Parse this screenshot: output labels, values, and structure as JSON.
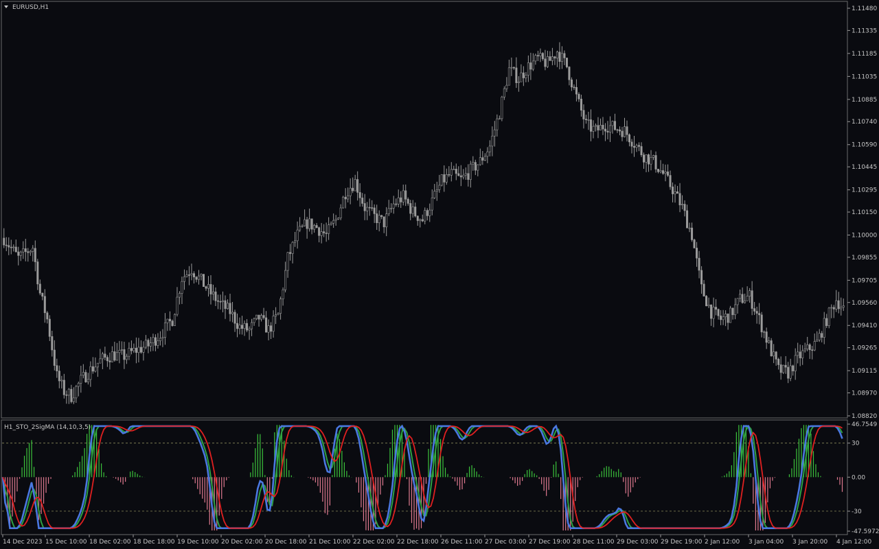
{
  "chart_data": [
    {
      "type": "candlestick",
      "title": "EURUSD,H1",
      "y_ticks": [
        "1.11480",
        "1.11335",
        "1.11185",
        "1.11035",
        "1.10885",
        "1.10740",
        "1.10590",
        "1.10445",
        "1.10295",
        "1.10150",
        "1.10000",
        "1.09855",
        "1.09705",
        "1.09560",
        "1.09410",
        "1.09265",
        "1.09115",
        "1.08970",
        "1.08820"
      ],
      "ylim": [
        1.0882,
        1.1148
      ],
      "x_ticks": [
        "14 Dec 2023",
        "15 Dec 10:00",
        "18 Dec 02:00",
        "18 Dec 18:00",
        "19 Dec 10:00",
        "20 Dec 02:00",
        "20 Dec 18:00",
        "21 Dec 10:00",
        "22 Dec 02:00",
        "22 Dec 18:00",
        "26 Dec 11:00",
        "27 Dec 03:00",
        "27 Dec 19:00",
        "28 Dec 11:00",
        "29 Dec 03:00",
        "29 Dec 19:00",
        "2 Jan 12:00",
        "3 Jan 04:00",
        "3 Jan 20:00",
        "4 Jan 12:00"
      ],
      "close_path": [
        [
          0,
          1.0998
        ],
        [
          6,
          1.0985
        ],
        [
          12,
          1.0992
        ],
        [
          15,
          1.0962
        ],
        [
          18,
          1.0945
        ],
        [
          22,
          1.0908
        ],
        [
          25,
          1.0898
        ],
        [
          28,
          1.0895
        ],
        [
          32,
          1.0905
        ],
        [
          36,
          1.0912
        ],
        [
          40,
          1.0918
        ],
        [
          45,
          1.0922
        ],
        [
          50,
          1.0921
        ],
        [
          55,
          1.0925
        ],
        [
          60,
          1.0928
        ],
        [
          65,
          1.0935
        ],
        [
          70,
          1.0945
        ],
        [
          74,
          1.0972
        ],
        [
          78,
          1.0978
        ],
        [
          82,
          1.097
        ],
        [
          86,
          1.0962
        ],
        [
          90,
          1.0955
        ],
        [
          94,
          1.095
        ],
        [
          98,
          1.094
        ],
        [
          102,
          1.0938
        ],
        [
          106,
          1.0946
        ],
        [
          110,
          1.0938
        ],
        [
          114,
          1.0948
        ],
        [
          118,
          1.0985
        ],
        [
          122,
          1.1
        ],
        [
          126,
          1.1008
        ],
        [
          130,
          1.1005
        ],
        [
          134,
          1.1
        ],
        [
          138,
          1.101
        ],
        [
          142,
          1.1028
        ],
        [
          146,
          1.1035
        ],
        [
          150,
          1.1018
        ],
        [
          154,
          1.1012
        ],
        [
          158,
          1.1008
        ],
        [
          162,
          1.102
        ],
        [
          166,
          1.1025
        ],
        [
          170,
          1.1015
        ],
        [
          174,
          1.101
        ],
        [
          178,
          1.1022
        ],
        [
          182,
          1.1035
        ],
        [
          186,
          1.104
        ],
        [
          190,
          1.1036
        ],
        [
          194,
          1.1042
        ],
        [
          198,
          1.1048
        ],
        [
          202,
          1.1058
        ],
        [
          206,
          1.108
        ],
        [
          210,
          1.1108
        ],
        [
          214,
          1.1102
        ],
        [
          218,
          1.111
        ],
        [
          222,
          1.1115
        ],
        [
          226,
          1.1112
        ],
        [
          230,
          1.112
        ],
        [
          234,
          1.111
        ],
        [
          238,
          1.109
        ],
        [
          242,
          1.1072
        ],
        [
          246,
          1.1068
        ],
        [
          250,
          1.1072
        ],
        [
          254,
          1.107
        ],
        [
          258,
          1.1068
        ],
        [
          262,
          1.106
        ],
        [
          266,
          1.1052
        ],
        [
          270,
          1.1048
        ],
        [
          274,
          1.104
        ],
        [
          278,
          1.103
        ],
        [
          282,
          1.1018
        ],
        [
          286,
          1.1
        ],
        [
          290,
          1.0965
        ],
        [
          294,
          1.095
        ],
        [
          298,
          1.0945
        ],
        [
          302,
          1.0948
        ],
        [
          306,
          1.0958
        ],
        [
          310,
          1.096
        ],
        [
          314,
          1.0945
        ],
        [
          318,
          1.0928
        ],
        [
          322,
          1.0912
        ],
        [
          326,
          1.091
        ],
        [
          330,
          1.092
        ],
        [
          334,
          1.0925
        ],
        [
          338,
          1.093
        ],
        [
          342,
          1.0945
        ],
        [
          346,
          1.0958
        ],
        [
          349,
          1.0952
        ]
      ]
    },
    {
      "type": "line",
      "title": "H1_STO_2SigMA (14,10,3,5)",
      "y_ticks": [
        "46.7549",
        "30",
        "0.00",
        "-30",
        "-47.5972"
      ],
      "ylim": [
        -47.5972,
        46.7549
      ],
      "series": []
    }
  ]
}
